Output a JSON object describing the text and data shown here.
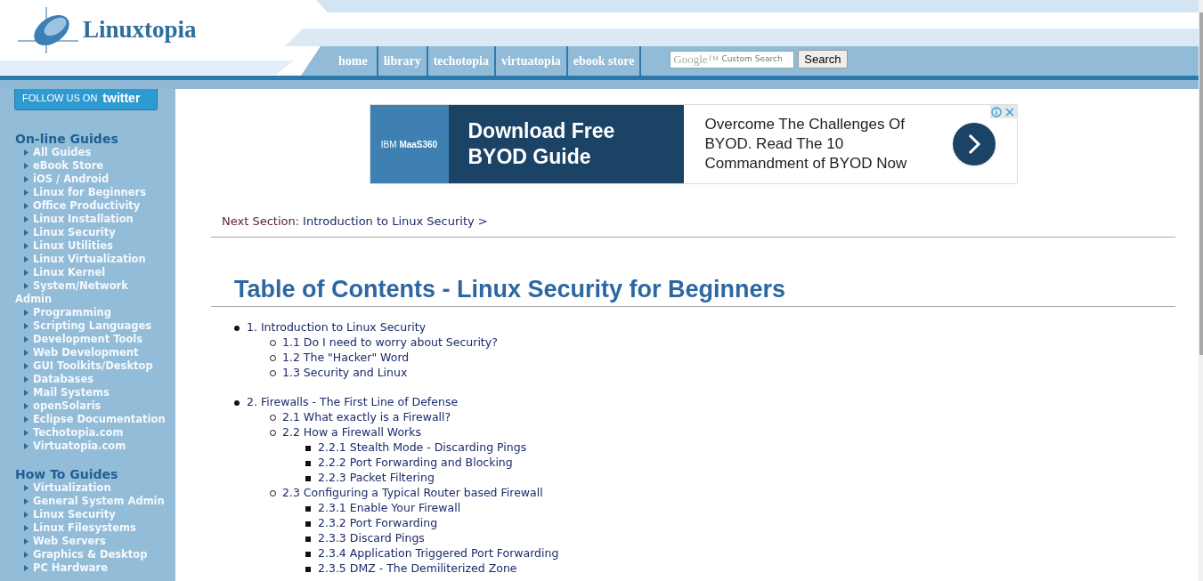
{
  "header": {
    "logo_text": "Linuxtopia",
    "nav": [
      {
        "label": "home"
      },
      {
        "label": "library"
      },
      {
        "label": "techotopia"
      },
      {
        "label": "virtuatopia"
      },
      {
        "label": "ebook store"
      }
    ],
    "search": {
      "brand": "Google™",
      "placeholder": "Custom Search",
      "button": "Search"
    }
  },
  "sidebar": {
    "follow_button": {
      "text": "FOLLOW US ON",
      "brand": "twitter"
    },
    "sections": [
      {
        "title": "On-line Guides",
        "items": [
          "All Guides",
          "eBook Store",
          "iOS / Android",
          "Linux for Beginners",
          "Office Productivity",
          "Linux Installation",
          "Linux Security",
          "Linux Utilities",
          "Linux Virtualization",
          "Linux Kernel",
          "System/Network Admin",
          "Programming",
          "Scripting Languages",
          "Development Tools",
          "Web Development",
          "GUI Toolkits/Desktop",
          "Databases",
          "Mail Systems",
          "openSolaris",
          "Eclipse Documentation",
          "Techotopia.com",
          "Virtuatopia.com"
        ]
      },
      {
        "title": "How To Guides",
        "items": [
          "Virtualization",
          "General System Admin",
          "Linux Security",
          "Linux Filesystems",
          "Web Servers",
          "Graphics & Desktop",
          "PC Hardware"
        ]
      }
    ]
  },
  "ad": {
    "sponsor": "IBM **MaaS360**",
    "headline": "Download Free BYOD Guide",
    "body": "Overcome The Challenges Of BYOD. Read The 10 Commandment of BYOD Now"
  },
  "next_section": {
    "label": "Next Section:",
    "link": "Introduction to Linux Security >"
  },
  "toc": {
    "title": "Table of Contents - Linux Security for Beginners",
    "items": [
      {
        "text": "1. Introduction to Linux Security",
        "children": [
          {
            "text": "1.1 Do I need to worry about Security?"
          },
          {
            "text": "1.2 The \"Hacker\" Word"
          },
          {
            "text": "1.3 Security and Linux"
          }
        ]
      },
      {
        "text": "2. Firewalls - The First Line of Defense",
        "children": [
          {
            "text": "2.1 What exactly is a Firewall?"
          },
          {
            "text": "2.2 How a Firewall Works",
            "children": [
              {
                "text": "2.2.1 Stealth Mode - Discarding Pings"
              },
              {
                "text": "2.2.2 Port Forwarding and Blocking"
              },
              {
                "text": "2.2.3 Packet Filtering"
              }
            ]
          },
          {
            "text": "2.3 Configuring a Typical Router based Firewall",
            "children": [
              {
                "text": "2.3.1 Enable Your Firewall"
              },
              {
                "text": "2.3.2 Port Forwarding"
              },
              {
                "text": "2.3.3 Discard Pings"
              },
              {
                "text": "2.3.4 Application Triggered Port Forwarding"
              },
              {
                "text": "2.3.5 DMZ - The Demiliterized Zone"
              }
            ]
          }
        ]
      }
    ]
  }
}
